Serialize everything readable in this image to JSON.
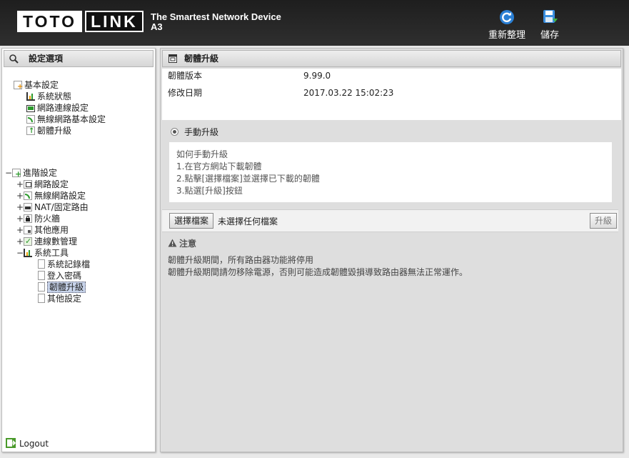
{
  "header": {
    "logo_left": "TOTO",
    "logo_right": "LINK",
    "tagline_line1": "The Smartest Network Device",
    "tagline_line2": "A3",
    "reboot_label": "重新整理",
    "save_label": "儲存"
  },
  "sidebar": {
    "title": "設定選項",
    "basic": {
      "label": "基本設定",
      "items": [
        "系統狀態",
        "網路連線設定",
        "無線網路基本設定",
        "韌體升級"
      ]
    },
    "advanced": {
      "label": "進階設定",
      "items": [
        "網路設定",
        "無線網路設定",
        "NAT/固定路由",
        "防火牆",
        "其他應用",
        "連線數管理",
        "系統工具"
      ],
      "tools_items": [
        "系統記錄檔",
        "登入密碼",
        "韌體升級",
        "其他設定"
      ]
    },
    "logout_label": "Logout"
  },
  "main": {
    "title": "韌體升級",
    "firmware_version_label": "韌體版本",
    "firmware_version_value": "9.99.0",
    "modified_date_label": "修改日期",
    "modified_date_value": "2017.03.22 15:02:23",
    "manual_upgrade_label": "手動升級",
    "howto_lines": [
      "如何手動升級",
      "1.在官方網站下載韌體",
      "2.點擊[選擇檔案]並選擇已下載的韌體",
      "3.點選[升級]按鈕"
    ],
    "choose_file_label": "選擇檔案",
    "no_file_label": "未選擇任何檔案",
    "upgrade_button_label": "升級",
    "notice_title": "注意",
    "notice_lines": [
      "韌體升級期間，所有路由器功能將停用",
      "韌體升級期間請勿移除電源，否則可能造成韌體毀損導致路由器無法正常運作。"
    ]
  }
}
